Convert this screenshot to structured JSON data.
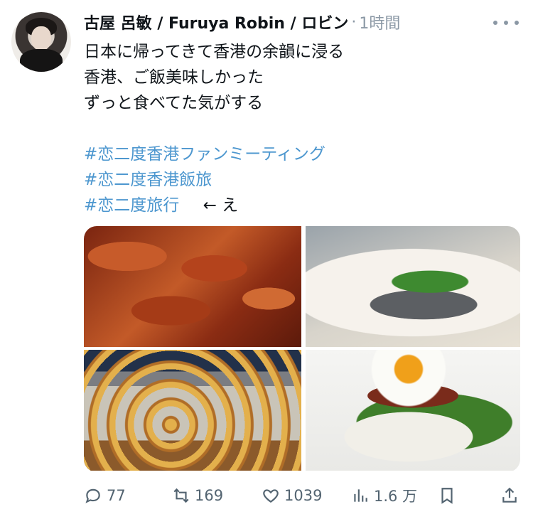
{
  "header": {
    "display_name": "古屋 呂敏 / Furuya Robin / ロビン",
    "separator": "·",
    "time": "1時間"
  },
  "post": {
    "lines": [
      "日本に帰ってきて香港の余韻に浸る",
      "香港、ご飯美味しかった",
      "ずっと食べてた気がする"
    ],
    "hashtags": [
      "#恋二度香港ファンミーティング",
      "#恋二度香港飯旅",
      "#恋二度旅行"
    ],
    "after_last_tag": "← え"
  },
  "media": [
    {
      "alt": "roast goose"
    },
    {
      "alt": "steamed fish"
    },
    {
      "alt": "egg tarts"
    },
    {
      "alt": "rice with fried egg"
    }
  ],
  "actions": {
    "reply_count": "77",
    "retweet_count": "169",
    "like_count": "1039",
    "view_count": "1.6 万"
  },
  "icons": {
    "more": "more-icon",
    "reply": "reply-icon",
    "retweet": "retweet-icon",
    "like": "heart-icon",
    "views": "views-icon",
    "bookmark": "bookmark-icon",
    "share": "share-icon"
  },
  "colors": {
    "hashtag": "#4d97cf",
    "secondary_text": "#536471",
    "primary_text": "#0f1419"
  }
}
